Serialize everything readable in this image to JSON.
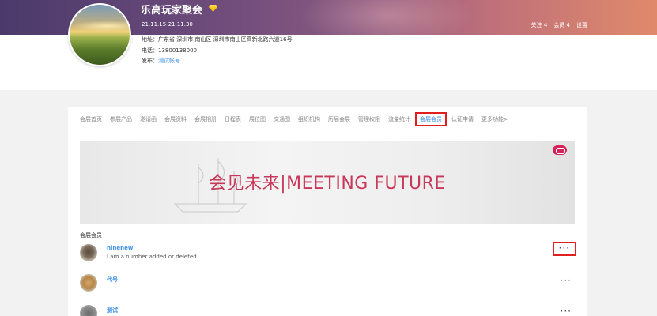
{
  "header": {
    "title": "乐高玩家聚会",
    "dates": "21.11.15-21.11.30",
    "stats": {
      "follow": "关注 4",
      "members": "会员 4",
      "settings": "设置"
    }
  },
  "info": {
    "address": "地址：广东省 深圳市 南山区 深圳市南山区高新北路六道16号",
    "phone": "电话：13800138000",
    "publisher_label": "发布：",
    "publisher": "测试帐号"
  },
  "nav": {
    "items": [
      {
        "label": "会展首页"
      },
      {
        "label": "参展产品"
      },
      {
        "label": "邀请函"
      },
      {
        "label": "会展资料"
      },
      {
        "label": "会展相册"
      },
      {
        "label": "日程表"
      },
      {
        "label": "展位图"
      },
      {
        "label": "交通图"
      },
      {
        "label": "组织机构"
      },
      {
        "label": "历届会展"
      },
      {
        "label": "管理权限"
      },
      {
        "label": "流量统计"
      },
      {
        "label": "会展会员"
      },
      {
        "label": "认证申请"
      },
      {
        "label": "更多功能>"
      }
    ]
  },
  "banner": {
    "cn": "会见未来",
    "sep": "|",
    "en": "MEETING FUTURE"
  },
  "members_section": {
    "title": "会展会员",
    "items": [
      {
        "name": "ninenew",
        "desc": "I am a number added or deleted",
        "more": "···"
      },
      {
        "name": "代号",
        "desc": "",
        "more": "···"
      },
      {
        "name": "测试",
        "desc": "",
        "more": "···"
      }
    ]
  },
  "colors": {
    "accent": "#3a8ee6",
    "highlight": "#e02020",
    "brand": "#c8385a"
  }
}
